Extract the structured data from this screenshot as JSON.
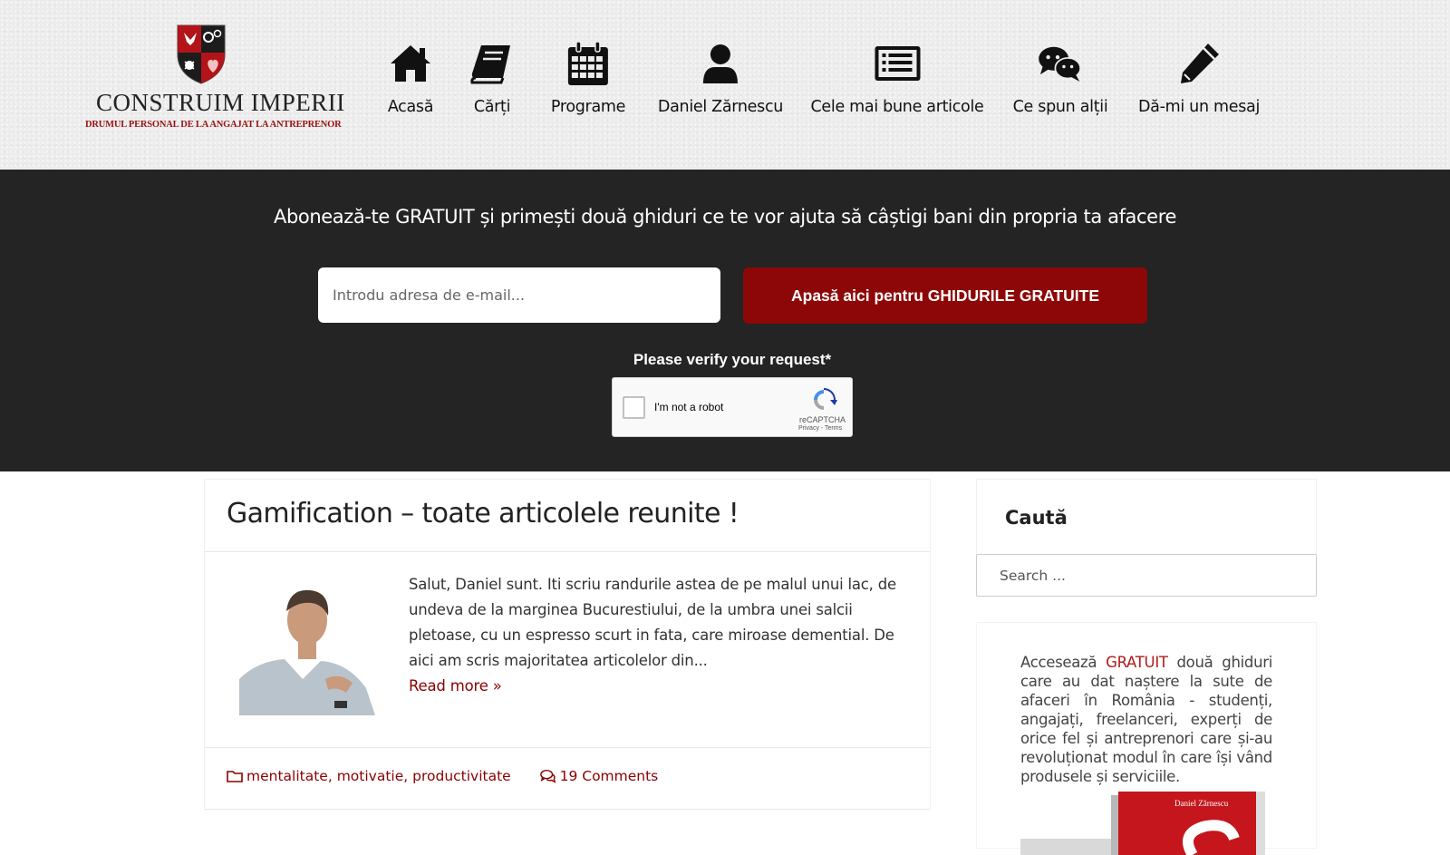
{
  "brand": {
    "logo_title": "CONSTRUIM IMPERII",
    "logo_subtitle": "DRUMUL PERSONAL DE LA ANGAJAT LA ANTREPRENOR"
  },
  "nav": {
    "items": [
      {
        "label": "Acasă",
        "icon": "home-icon"
      },
      {
        "label": "Cărți",
        "icon": "book-icon"
      },
      {
        "label": "Programe",
        "icon": "calendar-icon"
      },
      {
        "label": "Daniel Zărnescu",
        "icon": "user-icon"
      },
      {
        "label": "Cele mai bune articole",
        "icon": "list-icon"
      },
      {
        "label": "Ce spun alții",
        "icon": "chat-icon"
      },
      {
        "label": "Dă-mi un mesaj",
        "icon": "pencil-icon"
      }
    ]
  },
  "subscribe": {
    "headline": "Abonează-te GRATUIT și primești două ghiduri ce te vor ajuta să câștigi bani din propria ta afacere",
    "email_placeholder": "Introdu adresa de e-mail...",
    "button_label": "Apasă aici pentru GHIDURILE GRATUITE",
    "verify_label": "Please verify your request*",
    "captcha": {
      "label": "I'm not a robot",
      "brand": "reCAPTCHA",
      "links": "Privacy - Terms"
    }
  },
  "article": {
    "title": "Gamification – toate articolele reunite !",
    "excerpt": "Salut,  Daniel sunt. Iti scriu randurile astea de pe malul unui lac, de undeva de la marginea Bucurestiului, de la umbra unei salcii pletoase, cu un espresso scurt in fata, care miroase demential. De aici am scris majoritatea articolelor din...",
    "read_more": "Read more »",
    "categories": [
      "mentalitate",
      "motivatie",
      "productivitate"
    ],
    "comments": "19 Comments"
  },
  "sidebar": {
    "search_title": "Caută",
    "search_placeholder": "Search ...",
    "promo": {
      "text_before": "Accesează ",
      "text_accent": "GRATUIT",
      "text_after": " două ghiduri care au dat naștere la sute de afaceri în România - studenți, angajați, freelanceri, experți de orice fel și antreprenori care și-au revoluționat modul în care își vând produsele și serviciile.",
      "book_author": "Daniel Zărnescu"
    }
  },
  "colors": {
    "accent_red": "#8e0708",
    "link_red": "#8b0000",
    "band_bg": "#242424",
    "header_bg": "#ececec"
  }
}
